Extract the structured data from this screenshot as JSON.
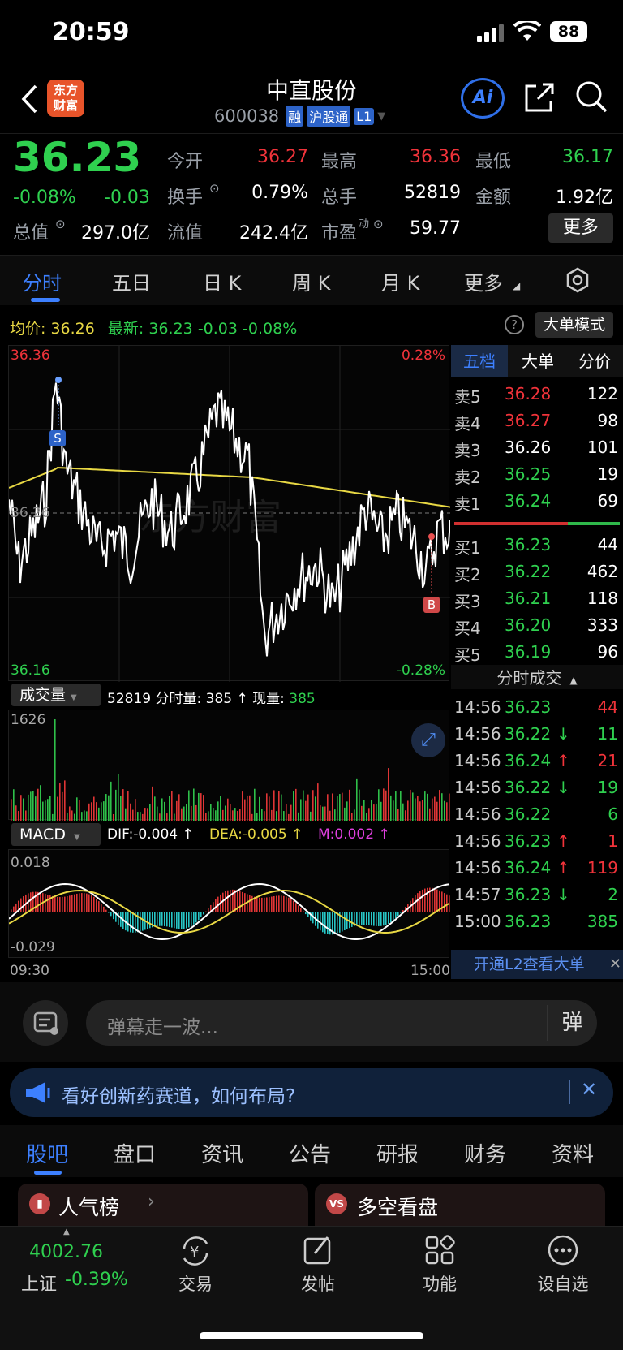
{
  "status": {
    "time": "20:59",
    "battery": "88"
  },
  "header": {
    "logo_top": "东方",
    "logo_bottom": "财富",
    "title": "中直股份",
    "code": "600038",
    "tags": [
      "融",
      "沪股通",
      "L1"
    ],
    "ai_label": "Ai"
  },
  "quote": {
    "price": "36.23",
    "pct": "-0.08%",
    "chg": "-0.03",
    "cells": [
      {
        "label": "今开",
        "value": "36.27",
        "color": "red"
      },
      {
        "label": "最高",
        "value": "36.36",
        "color": "red"
      },
      {
        "label": "最低",
        "value": "36.17",
        "color": "green"
      },
      {
        "label": "换手",
        "value": "0.79%",
        "color": "white"
      },
      {
        "label": "总手",
        "value": "52819",
        "color": "white"
      },
      {
        "label": "金额",
        "value": "1.92亿",
        "color": "white"
      },
      {
        "label": "总值",
        "value": "297.0亿",
        "color": "white"
      },
      {
        "label": "流值",
        "value": "242.4亿",
        "color": "white"
      },
      {
        "label": "市盈",
        "value": "59.77",
        "color": "white"
      }
    ],
    "pe_sup": "动",
    "more_button": "更多"
  },
  "tabs": [
    "分时",
    "五日",
    "日 K",
    "周 K",
    "月 K",
    "更多"
  ],
  "infobar": {
    "avg_label": "均价:",
    "avg": "36.26",
    "latest_label": "最新:",
    "latest": "36.23",
    "chg": "-0.03",
    "pct": "-0.08%",
    "mode_button": "大单模式",
    "help": "?"
  },
  "chart": {
    "y_high": "36.36",
    "y_low": "36.16",
    "y_mid": "36.26",
    "pct_high": "0.28%",
    "pct_low": "-0.28%",
    "marker_s": "S",
    "marker_b": "B",
    "watermark": "东方财富",
    "vol_button": "成交量",
    "vol_total": "52819",
    "vol_detail_label": "分时量:",
    "vol_detail": "385",
    "vol_arrow": "↑",
    "now_label": "现量:",
    "now_value": "385",
    "vol_max": "1626",
    "macd_button": "MACD",
    "dif": "DIF:-0.004 ↑",
    "dea": "DEA:-0.005 ↑",
    "m": "M:0.002 ↑",
    "macd_high": "0.018",
    "macd_low": "-0.029",
    "time_start": "09:30",
    "time_end": "15:00"
  },
  "chart_data": {
    "type": "line",
    "title": "",
    "ylim": [
      36.16,
      36.36
    ],
    "x_range": [
      "09:30",
      "15:00"
    ],
    "series": [],
    "volume_max": 1626,
    "macd": {
      "dif": -0.004,
      "dea": -0.005,
      "m": 0.002,
      "ylim": [
        -0.029,
        0.018
      ]
    }
  },
  "orderbook": {
    "tabs": [
      "五档",
      "大单",
      "分价"
    ],
    "asks": [
      {
        "label": "卖5",
        "price": "36.28",
        "vol": "122",
        "color": "red"
      },
      {
        "label": "卖4",
        "price": "36.27",
        "vol": "98",
        "color": "red"
      },
      {
        "label": "卖3",
        "price": "36.26",
        "vol": "101",
        "color": "white"
      },
      {
        "label": "卖2",
        "price": "36.25",
        "vol": "19",
        "color": "green"
      },
      {
        "label": "卖1",
        "price": "36.24",
        "vol": "69",
        "color": "green"
      }
    ],
    "bids": [
      {
        "label": "买1",
        "price": "36.23",
        "vol": "44",
        "color": "green"
      },
      {
        "label": "买2",
        "price": "36.22",
        "vol": "462",
        "color": "green"
      },
      {
        "label": "买3",
        "price": "36.21",
        "vol": "118",
        "color": "green"
      },
      {
        "label": "买4",
        "price": "36.20",
        "vol": "333",
        "color": "green"
      },
      {
        "label": "买5",
        "price": "36.19",
        "vol": "96",
        "color": "green"
      }
    ]
  },
  "trades": {
    "title": "分时成交",
    "rows": [
      {
        "time": "14:56",
        "price": "36.23",
        "arrow": "",
        "vol": "44",
        "vcolor": "red"
      },
      {
        "time": "14:56",
        "price": "36.22",
        "arrow": "↓",
        "vol": "11",
        "vcolor": "green"
      },
      {
        "time": "14:56",
        "price": "36.24",
        "arrow": "↑",
        "vol": "21",
        "vcolor": "red"
      },
      {
        "time": "14:56",
        "price": "36.22",
        "arrow": "↓",
        "vol": "19",
        "vcolor": "green"
      },
      {
        "time": "14:56",
        "price": "36.22",
        "arrow": "",
        "vol": "6",
        "vcolor": "green"
      },
      {
        "time": "14:56",
        "price": "36.23",
        "arrow": "↑",
        "vol": "1",
        "vcolor": "red"
      },
      {
        "time": "14:56",
        "price": "36.24",
        "arrow": "↑",
        "vol": "119",
        "vcolor": "red"
      },
      {
        "time": "14:57",
        "price": "36.23",
        "arrow": "↓",
        "vol": "2",
        "vcolor": "green"
      },
      {
        "time": "15:00",
        "price": "36.23",
        "arrow": "",
        "vol": "385",
        "vcolor": "green"
      }
    ],
    "l2_banner": "开通L2查看大单"
  },
  "danmu": {
    "placeholder": "弹幕走一波...",
    "send": "弹"
  },
  "notice": {
    "text": "看好创新药赛道，如何布局?"
  },
  "bottom_tabs": [
    "股吧",
    "盘口",
    "资讯",
    "公告",
    "研报",
    "财务",
    "资料"
  ],
  "cards": [
    {
      "label": "人气榜"
    },
    {
      "label": "多空看盘"
    }
  ],
  "nav": {
    "index_value": "4002.76",
    "index_name": "上证",
    "index_pct": "-0.39%",
    "items": [
      "交易",
      "发帖",
      "功能",
      "设自选"
    ]
  }
}
